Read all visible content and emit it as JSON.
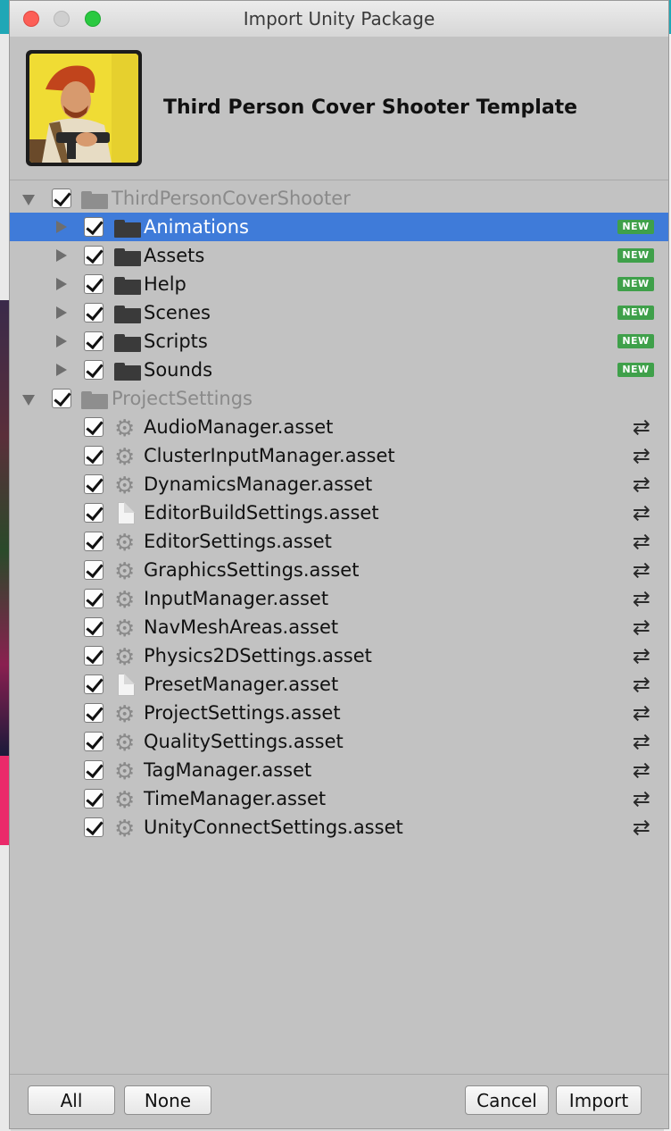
{
  "window": {
    "title": "Import Unity Package"
  },
  "package": {
    "name": "Third Person Cover Shooter Template"
  },
  "badges": {
    "new": "NEW"
  },
  "tree": {
    "roots": [
      {
        "label": "ThirdPersonCoverShooter",
        "checked": true,
        "expanded": true,
        "children": [
          {
            "label": "Animations",
            "type": "folder",
            "status": "NEW",
            "checked": true,
            "selected": true
          },
          {
            "label": "Assets",
            "type": "folder",
            "status": "NEW",
            "checked": true
          },
          {
            "label": "Help",
            "type": "folder",
            "status": "NEW",
            "checked": true
          },
          {
            "label": "Scenes",
            "type": "folder",
            "status": "NEW",
            "checked": true
          },
          {
            "label": "Scripts",
            "type": "folder",
            "status": "NEW",
            "checked": true
          },
          {
            "label": "Sounds",
            "type": "folder",
            "status": "NEW",
            "checked": true
          }
        ]
      },
      {
        "label": "ProjectSettings",
        "checked": true,
        "expanded": true,
        "children": [
          {
            "label": "AudioManager.asset",
            "type": "gear",
            "status": "changed",
            "checked": true
          },
          {
            "label": "ClusterInputManager.asset",
            "type": "gear",
            "status": "changed",
            "checked": true
          },
          {
            "label": "DynamicsManager.asset",
            "type": "gear",
            "status": "changed",
            "checked": true
          },
          {
            "label": "EditorBuildSettings.asset",
            "type": "doc",
            "status": "changed",
            "checked": true
          },
          {
            "label": "EditorSettings.asset",
            "type": "gear",
            "status": "changed",
            "checked": true
          },
          {
            "label": "GraphicsSettings.asset",
            "type": "gear",
            "status": "changed",
            "checked": true
          },
          {
            "label": "InputManager.asset",
            "type": "gear",
            "status": "changed",
            "checked": true
          },
          {
            "label": "NavMeshAreas.asset",
            "type": "gear",
            "status": "changed",
            "checked": true
          },
          {
            "label": "Physics2DSettings.asset",
            "type": "gear",
            "status": "changed",
            "checked": true
          },
          {
            "label": "PresetManager.asset",
            "type": "doc",
            "status": "changed",
            "checked": true
          },
          {
            "label": "ProjectSettings.asset",
            "type": "gear",
            "status": "changed",
            "checked": true
          },
          {
            "label": "QualitySettings.asset",
            "type": "gear",
            "status": "changed",
            "checked": true
          },
          {
            "label": "TagManager.asset",
            "type": "gear",
            "status": "changed",
            "checked": true
          },
          {
            "label": "TimeManager.asset",
            "type": "gear",
            "status": "changed",
            "checked": true
          },
          {
            "label": "UnityConnectSettings.asset",
            "type": "gear",
            "status": "changed",
            "checked": true
          }
        ]
      }
    ]
  },
  "buttons": {
    "all": "All",
    "none": "None",
    "cancel": "Cancel",
    "import": "Import"
  },
  "colors": {
    "selection": "#3f7bd9",
    "new_badge": "#3fa04a",
    "panel": "#c2c2c2"
  }
}
